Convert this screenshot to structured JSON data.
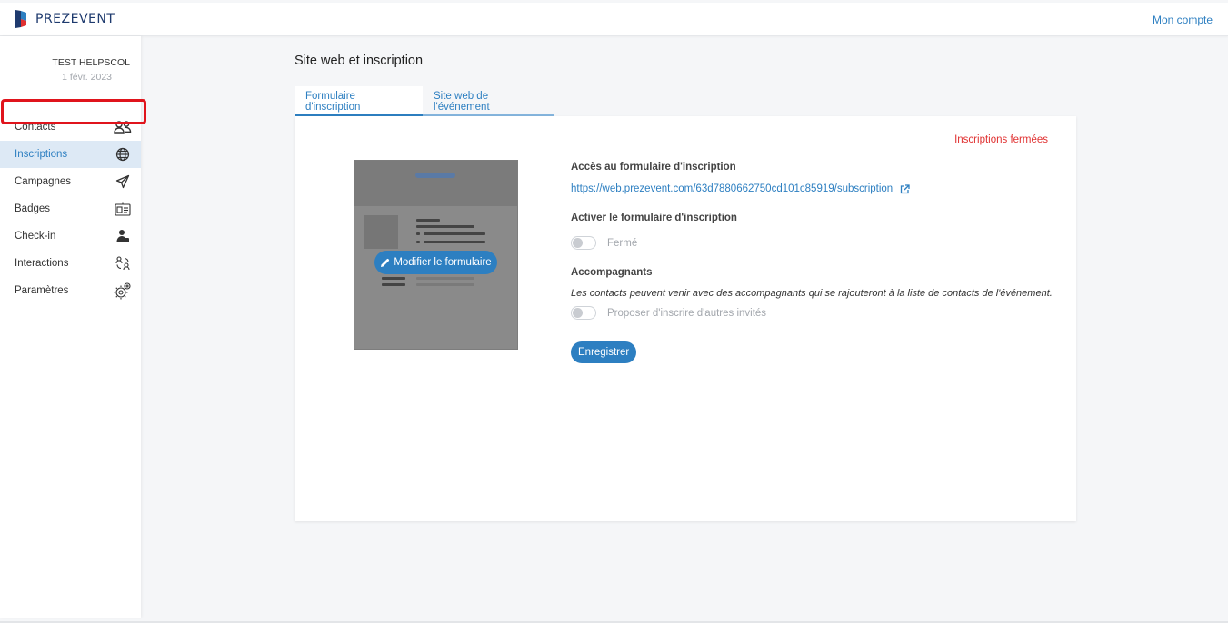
{
  "header": {
    "logo_text": "PREZEVENT",
    "account_link": "Mon compte"
  },
  "event": {
    "name": "TEST HELPSCOL",
    "date": "1 févr. 2023"
  },
  "sidebar": {
    "items": [
      {
        "label": "Contacts",
        "icon": "contacts-icon",
        "active": false
      },
      {
        "label": "Inscriptions",
        "icon": "globe-icon",
        "active": true
      },
      {
        "label": "Campagnes",
        "icon": "paper-plane-icon",
        "active": false
      },
      {
        "label": "Badges",
        "icon": "badge-icon",
        "active": false
      },
      {
        "label": "Check-in",
        "icon": "check-in-icon",
        "active": false
      },
      {
        "label": "Interactions",
        "icon": "interactions-icon",
        "active": false
      },
      {
        "label": "Paramètres",
        "icon": "gears-icon",
        "active": false
      }
    ]
  },
  "main": {
    "title": "Site web et inscription",
    "tabs": [
      {
        "label": "Formulaire d'inscription",
        "active": true
      },
      {
        "label": "Site web de l'événement",
        "active": false
      }
    ],
    "status": "Inscriptions fermées",
    "preview": {
      "edit_button": "Modifier le formulaire"
    },
    "form": {
      "access_label": "Accès au formulaire d'inscription",
      "url": "https://web.prezevent.com/63d7880662750cd101c85919/subscription",
      "activate_label": "Activer le formulaire d'inscription",
      "activate_toggle_text": "Fermé",
      "activate_toggle_on": false,
      "companions_label": "Accompagnants",
      "companions_help": "Les contacts peuvent venir avec des accompagnants qui se rajouteront à la liste de contacts de l'événement.",
      "companions_toggle_text": "Proposer d'inscrire d'autres invités",
      "companions_toggle_on": false,
      "save_button": "Enregistrer"
    }
  },
  "colors": {
    "accent": "#2d7fc1",
    "status_closed": "#e03131",
    "highlight": "#e0141c"
  }
}
